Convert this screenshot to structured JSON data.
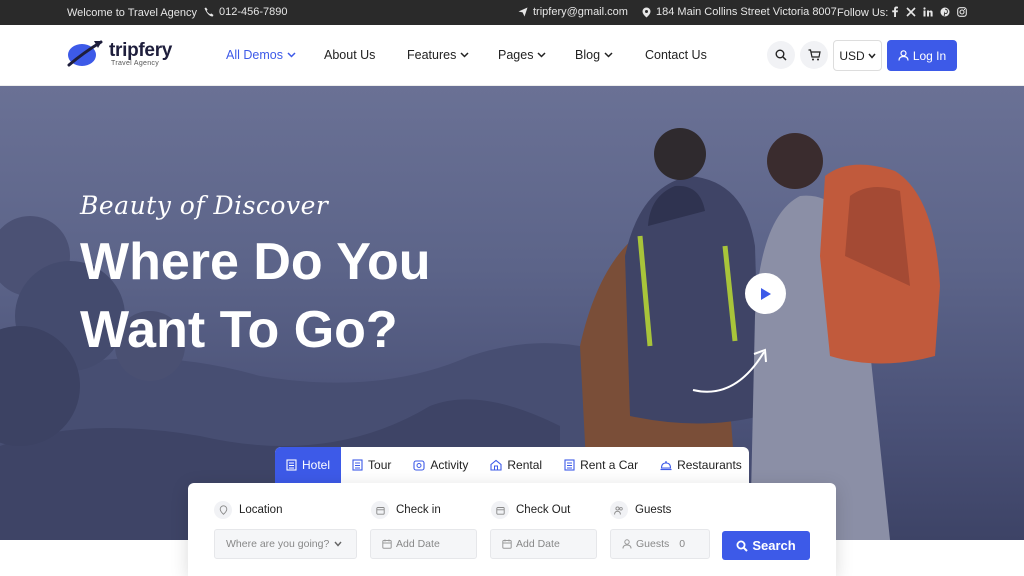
{
  "topbar": {
    "welcome": "Welcome to Travel Agency",
    "phone": "012-456-7890",
    "email": "tripfery@gmail.com",
    "address": "184 Main Collins Street Victoria 8007",
    "follow_label": "Follow Us:",
    "socials": [
      "facebook-icon",
      "x-icon",
      "linkedin-icon",
      "pinterest-icon",
      "instagram-icon"
    ]
  },
  "header": {
    "logo_name": "tripfery",
    "logo_sub": "Travel Agency",
    "nav": [
      {
        "label": "All Demos",
        "dropdown": true,
        "active": true
      },
      {
        "label": "About Us",
        "dropdown": false
      },
      {
        "label": "Features",
        "dropdown": true
      },
      {
        "label": "Pages",
        "dropdown": true
      },
      {
        "label": "Blog",
        "dropdown": true
      },
      {
        "label": "Contact Us",
        "dropdown": false
      }
    ],
    "currency": "USD",
    "login_label": "Log In"
  },
  "hero": {
    "tagline": "Beauty of Discover",
    "headline": "Where Do You Want To Go?"
  },
  "search": {
    "tabs": [
      "Hotel",
      "Tour",
      "Activity",
      "Rental",
      "Rent a Car",
      "Restaurants"
    ],
    "active_tab": "Hotel",
    "location_label": "Location",
    "location_placeholder": "Where are you going?",
    "checkin_label": "Check in",
    "checkin_placeholder": "Add Date",
    "checkout_label": "Check Out",
    "checkout_placeholder": "Add Date",
    "guests_label": "Guests",
    "guests_placeholder": "Guests",
    "guests_value": "0",
    "search_label": "Search"
  },
  "colors": {
    "accent": "#3d5ae8",
    "topbar_bg": "#2a2a2a",
    "hero_tint": "#5c6489"
  }
}
